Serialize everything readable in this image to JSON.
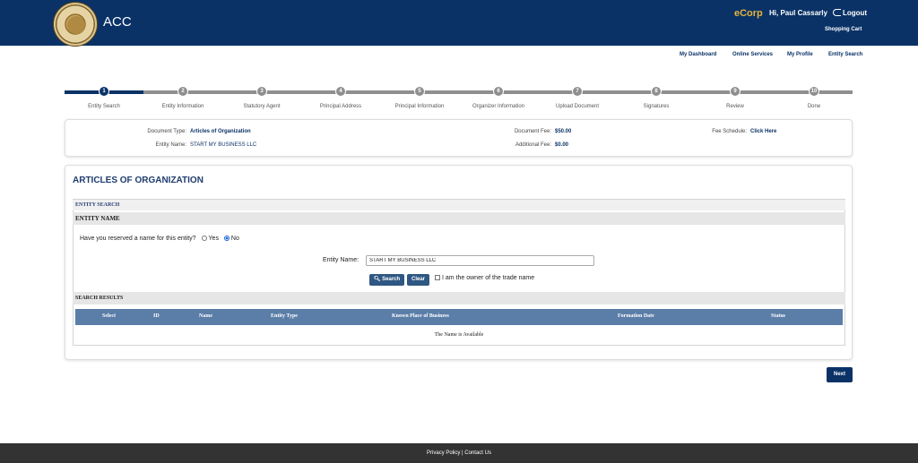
{
  "header": {
    "app_title": "ACC",
    "brand": "eCorp",
    "greeting": "Hi, Paul Cassarly",
    "logout": "Logout",
    "shopping_cart": "Shopping Cart",
    "background": "#0a3267",
    "brand_color": "#e7b43c"
  },
  "topnav": [
    "My Dashboard",
    "Online Services",
    "My Profile",
    "Entity Search"
  ],
  "steps": [
    {
      "num": "1",
      "label": "Entity Search"
    },
    {
      "num": "2",
      "label": "Entity Information"
    },
    {
      "num": "3",
      "label": "Statutory Agent"
    },
    {
      "num": "4",
      "label": "Principal Address"
    },
    {
      "num": "5",
      "label": "Principal Information"
    },
    {
      "num": "6",
      "label": "Organizer Information"
    },
    {
      "num": "7",
      "label": "Upload Document"
    },
    {
      "num": "8",
      "label": "Signatures"
    },
    {
      "num": "9",
      "label": "Review"
    },
    {
      "num": "10",
      "label": "Done"
    }
  ],
  "current_step": 1,
  "info": {
    "doc_type_label": "Document Type:",
    "doc_type_value": "Articles of Organization",
    "entity_name_label": "Entity Name:",
    "entity_name_value": "START MY BUSINESS LLC",
    "doc_fee_label": "Document Fee:",
    "doc_fee_value": "$50.00",
    "add_fee_label": "Additional Fee:",
    "add_fee_value": "$0.00",
    "fee_schedule_label": "Fee Schedule:",
    "fee_schedule_link": "Click Here"
  },
  "form": {
    "title": "ARTICLES OF ORGANIZATION",
    "entity_search_band": "ENTITY SEARCH",
    "entity_name_band": "ENTITY NAME",
    "reserve_question": "Have you reserved a name for this entity?",
    "yes_label": "Yes",
    "no_label": "No",
    "reserved": "No",
    "entity_name_field_label": "Entity Name:",
    "entity_name_value": "START MY BUSINESS LLC",
    "search_button": "Search",
    "clear_button": "Clear",
    "owner_label": "I am the owner of the trade name"
  },
  "results": {
    "band": "SEARCH RESULTS",
    "columns": [
      "Select",
      "ID",
      "Name",
      "Entity Type",
      "Known Place of Business",
      "Formation Date",
      "Status"
    ],
    "message": "The Name is Available"
  },
  "next_button": "Next",
  "footer": {
    "text": "Privacy Policy | Contact Us"
  }
}
